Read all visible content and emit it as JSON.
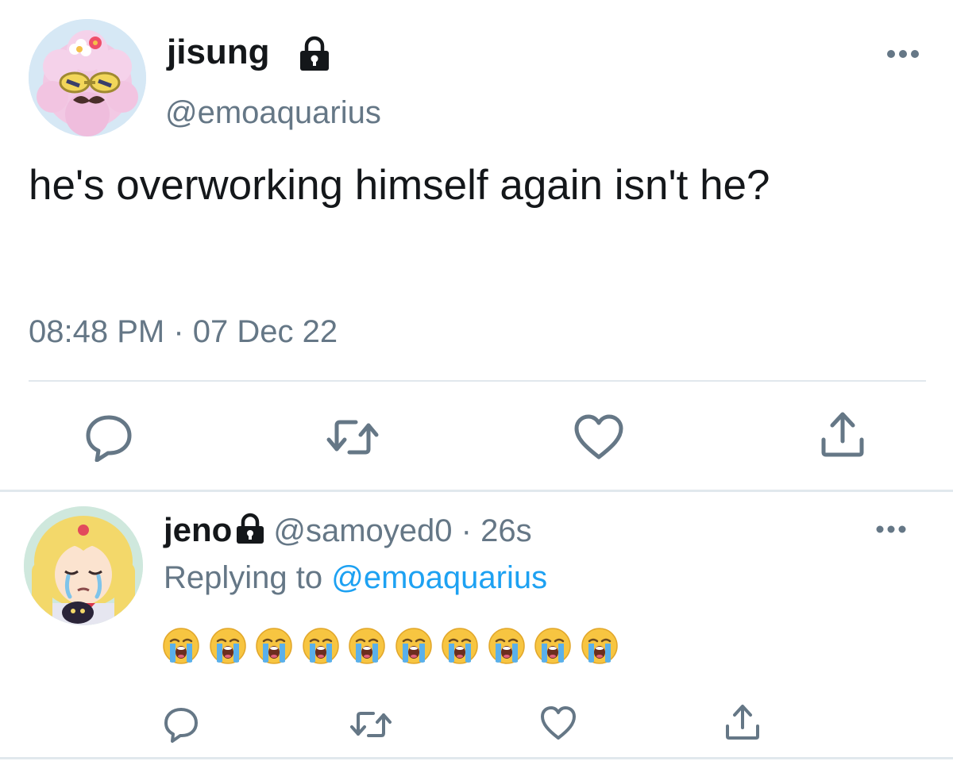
{
  "colors": {
    "text": "#14171a",
    "secondary": "#657786",
    "link": "#1da1f2",
    "divider": "#e1e8ed",
    "icon": "#657786"
  },
  "main_tweet": {
    "display_name": "jisung",
    "locked_icon": "lock-icon",
    "handle": "@emoaquarius",
    "text": "he's overworking himself again isn't he?",
    "timestamp": "08:48 PM · 07 Dec 22",
    "actions": [
      "reply-icon",
      "retweet-icon",
      "like-icon",
      "share-icon"
    ],
    "more_icon": "more-icon"
  },
  "reply_tweet": {
    "display_name": "jeno",
    "locked_icon": "lock-icon",
    "handle": "@samoyed0",
    "separator": "·",
    "time": "26s",
    "replying_prefix": "Replying to ",
    "replying_to": "@emoaquarius",
    "emojis": [
      "😭",
      "😭",
      "😭",
      "😭",
      "😭",
      "😭",
      "😭",
      "😭",
      "😭",
      "😭"
    ],
    "actions": [
      "reply-icon",
      "retweet-icon",
      "like-icon",
      "share-icon"
    ],
    "more_icon": "more-icon"
  }
}
